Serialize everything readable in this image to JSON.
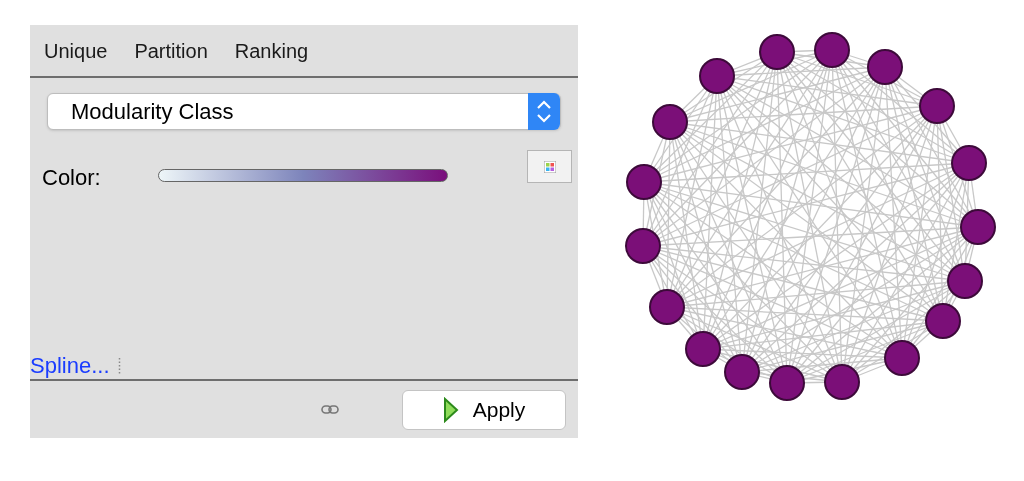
{
  "tabs": [
    {
      "label": "Unique"
    },
    {
      "label": "Partition"
    },
    {
      "label": "Ranking"
    }
  ],
  "attribute_dropdown": {
    "value": "Modularity Class"
  },
  "color_row": {
    "label": "Color:"
  },
  "spline_link": "Spline...",
  "apply_button": "Apply"
}
